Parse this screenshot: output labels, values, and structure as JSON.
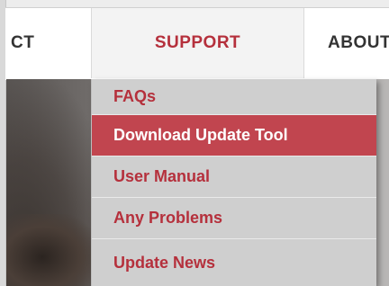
{
  "nav": {
    "contact_label": "CT",
    "support_label": "SUPPORT",
    "about_label": "ABOUT"
  },
  "dropdown": {
    "items": [
      {
        "label": "FAQs",
        "active": false
      },
      {
        "label": "Download Update Tool",
        "active": true
      },
      {
        "label": "User Manual",
        "active": false
      },
      {
        "label": "Any Problems",
        "active": false
      },
      {
        "label": "Update News",
        "active": false
      }
    ]
  },
  "colors": {
    "accent": "#b5303c",
    "highlight_bg": "#c1454f",
    "menu_bg": "#cfcfcf",
    "nav_bg": "#ffffff"
  }
}
